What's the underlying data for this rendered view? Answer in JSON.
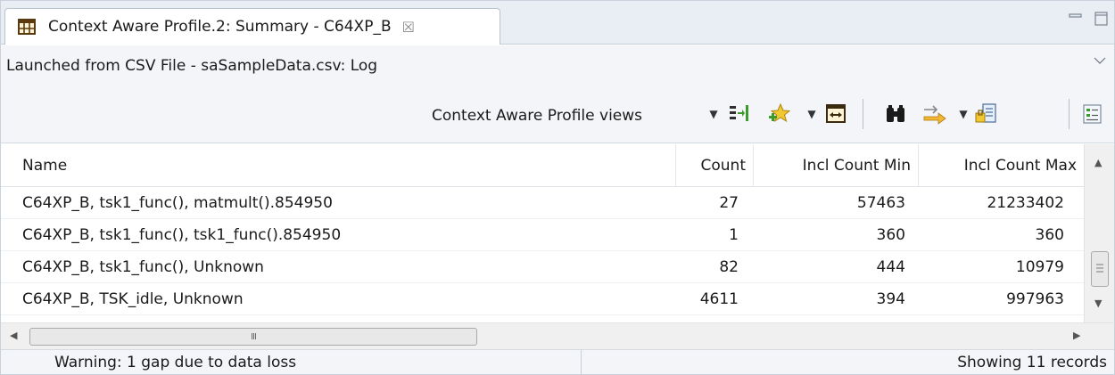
{
  "tab": {
    "icon": "table-grid-icon",
    "title": "Context Aware Profile.2: Summary - C64XP_B",
    "close_glyph": "☒"
  },
  "context": {
    "text": "Launched from CSV File - saSampleData.csv: Log"
  },
  "toolbar": {
    "views_label": "Context Aware Profile views",
    "icons": [
      "column-settings-icon",
      "star-add-icon",
      "fit-columns-icon",
      "find-binoculars-icon",
      "filter-arrows-icon",
      "export-icon",
      "toggle-view-icon"
    ]
  },
  "table": {
    "columns": [
      "Name",
      "Count",
      "Incl Count Min",
      "Incl Count Max"
    ],
    "rows": [
      {
        "name": "C64XP_B, tsk1_func(), matmult().854950",
        "count": "27",
        "incl_min": "57463",
        "incl_max": "21233402"
      },
      {
        "name": "C64XP_B, tsk1_func(), tsk1_func().854950",
        "count": "1",
        "incl_min": "360",
        "incl_max": "360"
      },
      {
        "name": "C64XP_B, tsk1_func(), Unknown",
        "count": "82",
        "incl_min": "444",
        "incl_max": "10979"
      },
      {
        "name": "C64XP_B, TSK_idle, Unknown",
        "count": "4611",
        "incl_min": "394",
        "incl_max": "997963"
      }
    ]
  },
  "hscroll": {
    "grip": "III"
  },
  "status": {
    "warning": "Warning: 1 gap due to data loss",
    "records": "Showing 11 records"
  },
  "colors": {
    "tab_bg": "#e9eef4",
    "toolbar_bg": "#f3f5f8",
    "icon_green": "#3a9a2a",
    "icon_gold": "#e0a020"
  }
}
